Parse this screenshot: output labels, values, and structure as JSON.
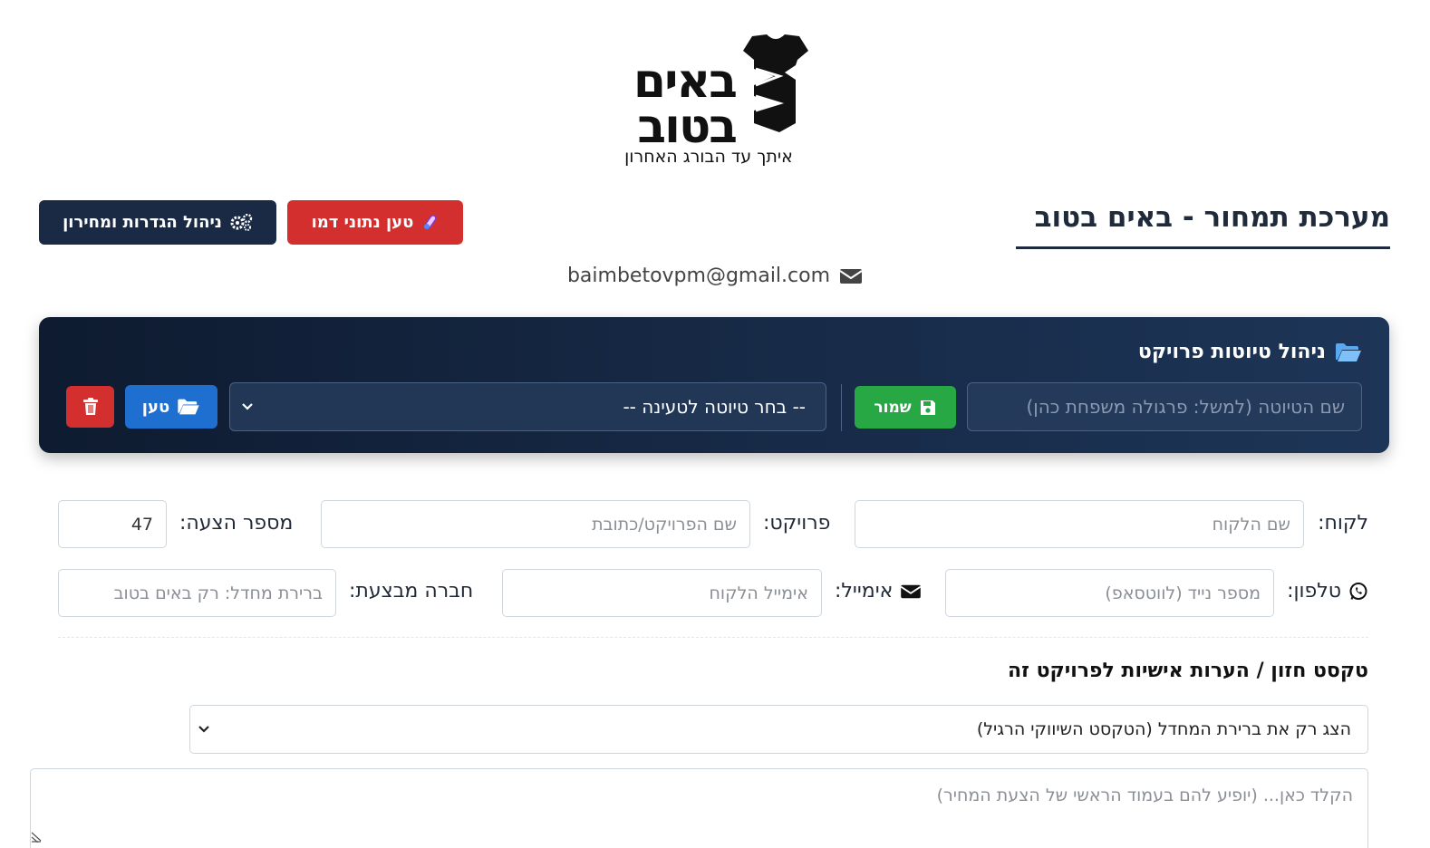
{
  "logo": {
    "word1": "באים",
    "word2": "בטוב",
    "tagline": "איתך עד הבורג האחרון"
  },
  "header": {
    "title": "מערכת תמחור - באים בטוב",
    "settings_button": "ניהול הגדרות ומחירון",
    "settings_icon": "gears-icon",
    "demo_button": "טען נתוני דמו",
    "demo_icon": "test-tube-icon",
    "email": "baimbetovpm@gmail.com",
    "email_icon": "envelope-icon"
  },
  "drafts": {
    "title": "ניהול טיוטות פרויקט",
    "title_icon": "folder-open-icon",
    "name_placeholder": "שם הטיוטה (למשל: פרגולה משפחת כהן)",
    "save_button": "שמור",
    "save_icon": "floppy-icon",
    "select_value": "-- בחר טיוטה לטעינה --",
    "load_button": "טען",
    "load_icon": "folder-open-icon",
    "delete_icon": "trash-icon"
  },
  "form": {
    "client_label": "לקוח:",
    "client_placeholder": "שם הלקוח",
    "project_label": "פרויקט:",
    "project_placeholder": "שם הפרויקט/כתובת",
    "quote_label": "מספר הצעה:",
    "quote_value": "47",
    "phone_label": "טלפון:",
    "phone_icon": "whatsapp-icon",
    "phone_placeholder": "מספר נייד (לווטסאפ)",
    "email_label": "אימייל:",
    "email_icon": "envelope-icon",
    "email_placeholder": "אימייל הלקוח",
    "company_label": "חברה מבצעת:",
    "company_placeholder": "ברירת מחדל: רק באים בטוב",
    "vision_heading": "טקסט חזון / הערות אישיות לפרויקט זה",
    "vision_select_value": "הצג רק את ברירת המחדל (הטקסט השיווקי הרגיל)",
    "notes_placeholder": "הקלד כאן... (יופיע להם בעמוד הראשי של הצעת המחיר)"
  },
  "colors": {
    "panel_dark": "#0e1b30",
    "settings_button": "#1a2a44",
    "danger": "#d42f2f",
    "success": "#28a745",
    "primary": "#1f6fd1"
  }
}
